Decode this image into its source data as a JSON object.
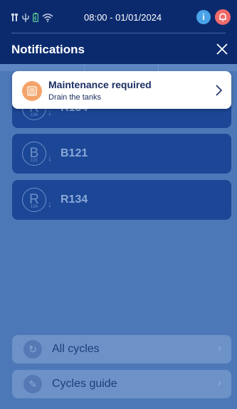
{
  "status": {
    "datetime": "08:00 - 01/01/2024",
    "icons": [
      "tools-icon",
      "usb-icon",
      "battery-icon",
      "wifi-icon"
    ],
    "info_label": "i"
  },
  "header": {
    "title": "Notifications"
  },
  "notification": {
    "title": "Maintenance required",
    "subtitle": "Drain the tanks"
  },
  "cycles": [
    {
      "letter": "R",
      "sub": "134",
      "label": "R134"
    },
    {
      "letter": "B",
      "sub": "121",
      "label": "B121"
    },
    {
      "letter": "R",
      "sub": "134",
      "label": "R134"
    }
  ],
  "buttons": {
    "all_cycles": "All cycles",
    "cycles_guide": "Cycles guide"
  },
  "colors": {
    "background": "#0b2a6e",
    "overlay": "#4d78b8",
    "card": "#1c4796",
    "notification_icon": "#f4a46a",
    "alert": "#f06a6a",
    "info": "#4aa3e8"
  }
}
